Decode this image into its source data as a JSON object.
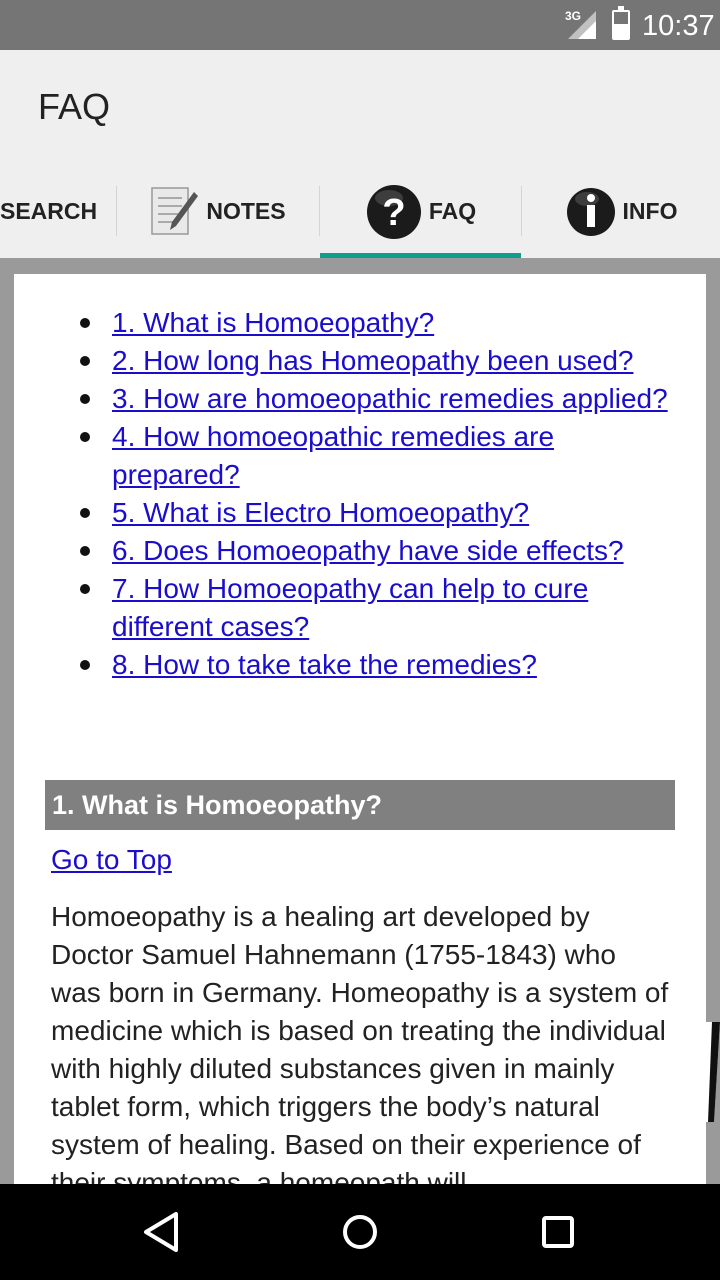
{
  "status": {
    "network": "3G",
    "time": "10:37"
  },
  "app": {
    "title": "FAQ"
  },
  "tabs": [
    {
      "label": "SEARCH",
      "icon": "search-icon"
    },
    {
      "label": "NOTES",
      "icon": "notes-icon"
    },
    {
      "label": "FAQ",
      "icon": "question-icon",
      "active": true
    },
    {
      "label": "INFO",
      "icon": "info-icon"
    }
  ],
  "toc": [
    "1. What is Homoeopathy?",
    "2. How long has Homeopathy been used?",
    "3. How are homoeopathic remedies applied?",
    "4. How homoeopathic remedies are prepared?",
    "5. What is Electro Homoeopathy?",
    "6. Does Homoeopathy have side effects?",
    "7. How Homoeopathy can help to cure different cases?",
    "8. How to take take the remedies?"
  ],
  "section": {
    "header": "1. What is Homoeopathy?",
    "go_top": "Go to Top",
    "body": "Homoeopathy is a healing art developed by Doctor Samuel Hahnemann (1755-1843) who was born in Germany. Homeopathy is a system of medicine which is based on treating the individual with highly diluted substances given in mainly tablet form, which triggers the body’s natural system of healing. Based on their experience of their symptoms, a homeopath will"
  },
  "nav": {
    "back": "back-icon",
    "home": "home-icon",
    "recents": "recents-icon"
  },
  "colors": {
    "accent": "#0f9d8c",
    "link": "#1a0dcc",
    "header_bg": "#808080"
  }
}
